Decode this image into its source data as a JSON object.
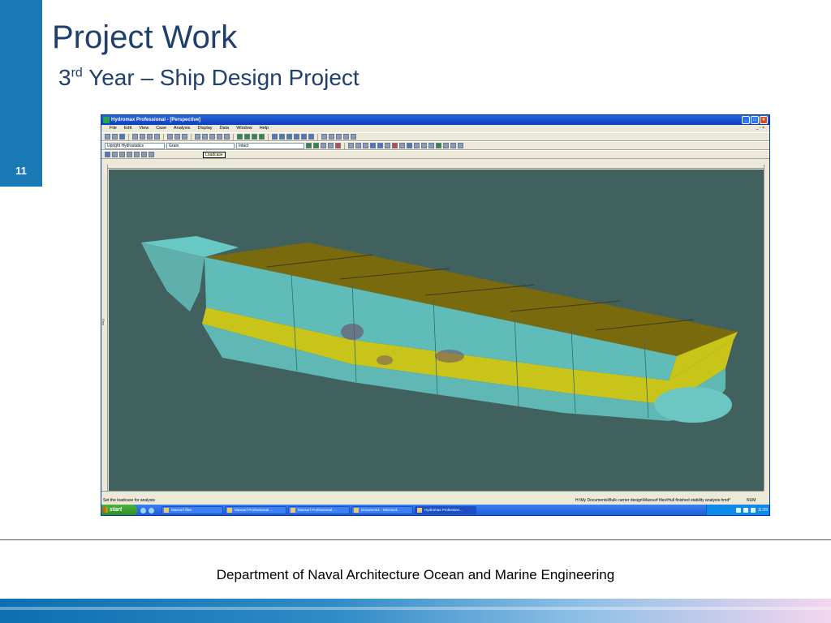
{
  "slide": {
    "title": "Project Work",
    "subtitle_prefix": "3",
    "subtitle_sup": "rd",
    "subtitle_rest": " Year – Ship Design Project",
    "number": "11",
    "footer": "Department of Naval Architecture Ocean and Marine Engineering"
  },
  "app": {
    "window_title": "Hydromax Professional - [Perspective]",
    "menu": [
      "File",
      "Edit",
      "View",
      "Case",
      "Analysis",
      "Display",
      "Data",
      "Window",
      "Help"
    ],
    "selects": {
      "analysis": "Upright Hydrostatics",
      "density": "Grain",
      "condition": "Intact"
    },
    "tooltip": "Loadcase",
    "ruler_side_label": "Plan",
    "status_left": "Set the loadcase for analysis",
    "status_path": "H:\\My Documents\\Bulk carrier design\\Maxsurf files\\Hull finished stability analysis.hmd*",
    "status_num": "NUM"
  },
  "taskbar": {
    "start": "start",
    "buttons": [
      "Maxsurf files",
      "Maxsurf Professional ...",
      "Maxsurf Professional ...",
      "Document1 - Microsof...",
      "Hydromax Profession..."
    ],
    "clock": "11:59"
  },
  "colors": {
    "viewport_bg": "#41615f",
    "hull_cyan": "#5fbcb8",
    "deck_olive": "#7a6a0e",
    "band_yellow": "#c8c41a"
  }
}
